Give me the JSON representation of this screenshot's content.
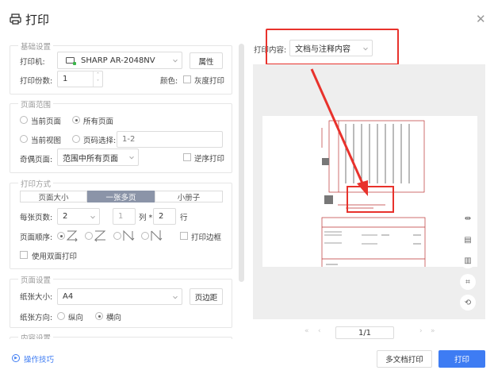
{
  "title": "打印",
  "basic": {
    "legend": "基础设置",
    "printer_label": "打印机:",
    "printer_value": "SHARP AR-2048NV",
    "properties_button": "属性",
    "copies_label": "打印份数:",
    "copies_value": "1",
    "color_label": "颜色:",
    "grayscale_label": "灰度打印"
  },
  "range": {
    "legend": "页面范围",
    "current_page": "当前页面",
    "all_pages": "所有页面",
    "current_view": "当前视图",
    "page_select": "页码选择:",
    "page_select_placeholder": "1-2",
    "odd_even_label": "奇偶页面:",
    "odd_even_value": "范围中所有页面",
    "reverse_label": "逆序打印"
  },
  "mode": {
    "legend": "打印方式",
    "tabs": [
      "页面大小",
      "一张多页",
      "小册子"
    ],
    "pages_per_sheet_label": "每张页数:",
    "pages_per_sheet_value": "2",
    "cols_value": "1",
    "cols_label": "列 *",
    "rows_value": "2",
    "rows_label": "行",
    "order_label": "页面顺序:",
    "border_label": "打印边框",
    "duplex_label": "使用双面打印"
  },
  "page_setup": {
    "legend": "页面设置",
    "paper_size_label": "纸张大小:",
    "paper_size_value": "A4",
    "margins_button": "页边距",
    "orientation_label": "纸张方向:",
    "portrait": "纵向",
    "landscape": "横向"
  },
  "content_settings_legend": "内容设置",
  "tips_link": "操作技巧",
  "print_content": {
    "label": "打印内容:",
    "value": "文档与注释内容"
  },
  "pagination": {
    "value": "1/1"
  },
  "buttons": {
    "multi_doc": "多文档打印",
    "print": "打印"
  },
  "colors": {
    "accent": "#3e7cf3",
    "annotation": "#e8322c",
    "active_tab": "#8b94a8"
  }
}
